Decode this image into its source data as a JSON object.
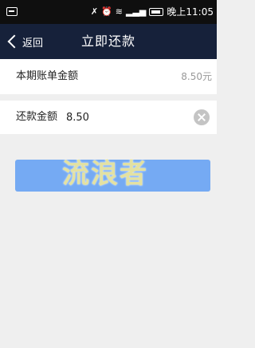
{
  "status_bar": {
    "left_icon": "notification-icon",
    "icons": [
      "mute-icon",
      "alarm-icon",
      "wifi-icon",
      "signal-icon"
    ],
    "time": "晚上11:05"
  },
  "nav": {
    "back_label": "返回",
    "title": "立即还款"
  },
  "bill": {
    "label": "本期账单金额",
    "value": "8.50元"
  },
  "repay": {
    "label": "还款金额",
    "value": "8.50"
  },
  "submit": {
    "label": ""
  },
  "watermark": {
    "text": "流浪者"
  },
  "colors": {
    "status_bar": "#0f0f0f",
    "nav_bar": "#16213a",
    "button": "#75aaf3",
    "background": "#efefef"
  }
}
